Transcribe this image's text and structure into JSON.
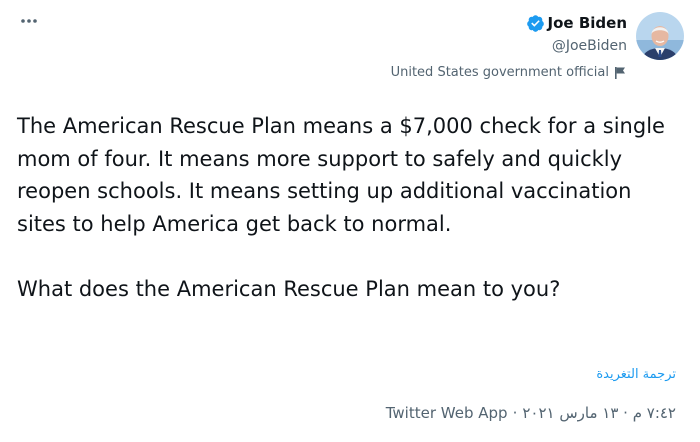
{
  "more_icon": "more-horizontal-icon",
  "author": {
    "name": "Joe Biden",
    "handle": "@JoeBiden",
    "verified_icon": "verified-badge-icon",
    "label": "United States government official",
    "label_icon": "flag-icon",
    "avatar": "avatar"
  },
  "tweet": {
    "text": "The American Rescue Plan means a $7,000 check for a single mom of four. It means more support to safely and quickly reopen schools. It means setting up additional vaccination sites to help America get back to normal.\n\nWhat does the American Rescue Plan mean to you?",
    "translate_label": "ترجمة التغريدة",
    "timestamp": "٧:٤٢ م · ١٣ مارس ٢٠٢١",
    "separator": "·",
    "source": "Twitter Web App"
  },
  "colors": {
    "link": "#1d9bf0",
    "verified": "#1d9bf0",
    "secondary_text": "#536471",
    "primary_text": "#0f1419"
  }
}
